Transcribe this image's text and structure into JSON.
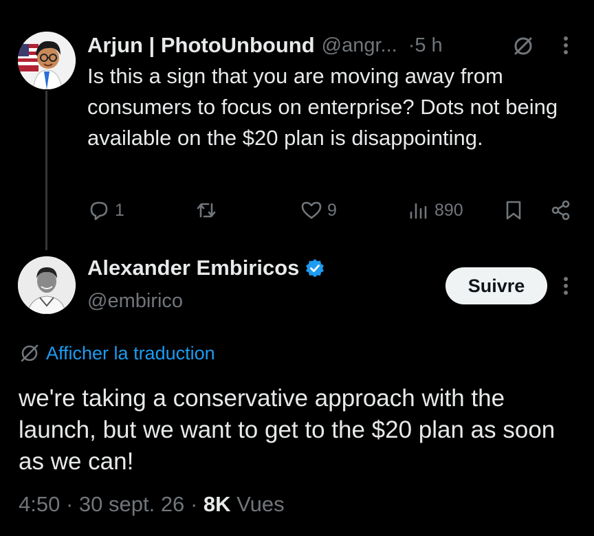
{
  "reply": {
    "name": "Arjun | PhotoUnbound",
    "handle": "@angr...",
    "time": "·5 h",
    "text": "Is this a sign that you are moving away from consumers to focus on enterprise? Dots not being available on the $20 plan is disappointing.",
    "replies": "1",
    "retweets": "",
    "likes": "9",
    "views": "890"
  },
  "main": {
    "name": "Alexander Embiricos",
    "handle": "@embirico",
    "follow_label": "Suivre",
    "translate_label": "Afficher la traduction",
    "text": "we're taking a conservative approach with the launch, but we want to get to the $20 plan as soon as we can!",
    "time": "4:50",
    "date": "30 sept. 26",
    "views_count": "8K",
    "views_label": "Vues"
  },
  "colors": {
    "background": "#000000",
    "text": "#e7e9ea",
    "muted": "#71767b",
    "accent": "#1d9bf0",
    "thread_line": "#333639"
  },
  "icons": [
    "grok-slash-icon",
    "more-icon",
    "reply-icon",
    "retweet-icon",
    "like-icon",
    "views-icon",
    "bookmark-icon",
    "share-icon",
    "verified-badge-icon",
    "translate-icon"
  ]
}
